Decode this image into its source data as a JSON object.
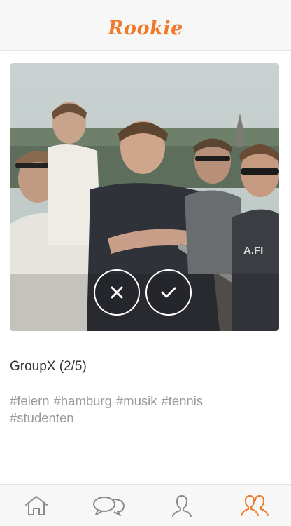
{
  "app": {
    "title": "Rookie"
  },
  "colors": {
    "accent": "#f07a2a",
    "tag_text": "#9a9a9a",
    "icon_inactive": "#8a8a8a"
  },
  "group": {
    "title": "GroupX (2/5)",
    "tags": [
      "#feiern",
      "#hamburg",
      "#musik",
      "#tennis",
      "#studenten"
    ]
  },
  "actions": {
    "reject": {
      "icon": "close-icon"
    },
    "accept": {
      "icon": "check-icon"
    }
  },
  "tabs": [
    {
      "name": "home",
      "icon": "home-icon",
      "active": false
    },
    {
      "name": "chats",
      "icon": "chat-bubbles-icon",
      "active": false
    },
    {
      "name": "profile",
      "icon": "person-icon",
      "active": false
    },
    {
      "name": "groups",
      "icon": "group-icon",
      "active": true
    }
  ]
}
